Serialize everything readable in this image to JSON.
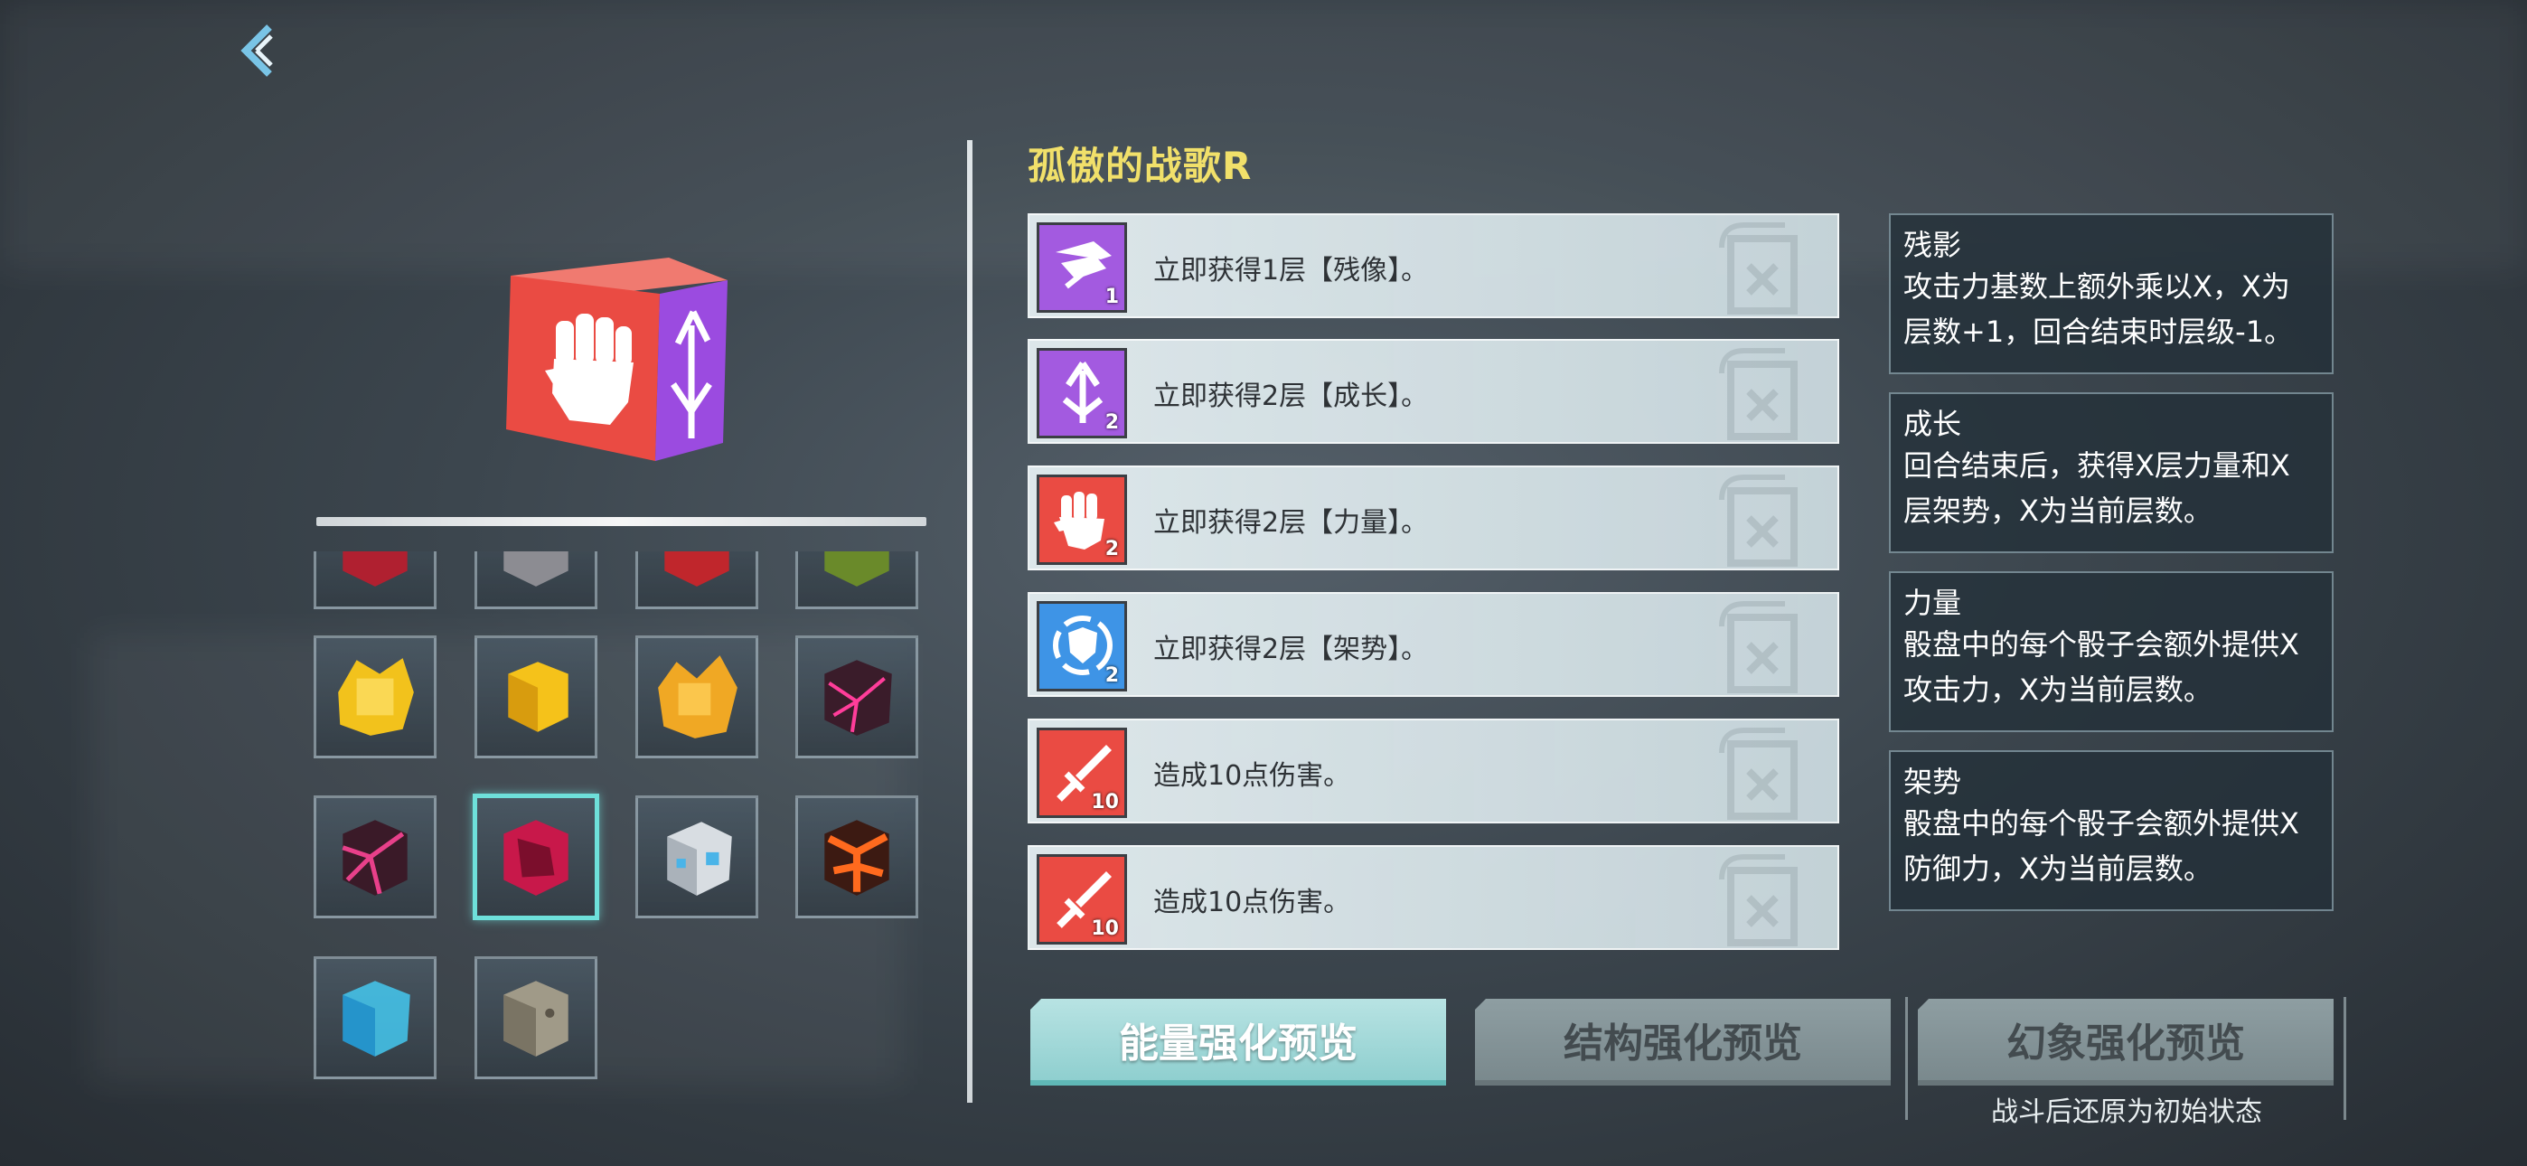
{
  "title": "孤傲的战歌R",
  "icons": {
    "back": "back-arrow-icon"
  },
  "effects": [
    {
      "text": "立即获得1层【残像】。",
      "count": "1",
      "icon": "afterimage-icon",
      "color": "#a35ae0"
    },
    {
      "text": "立即获得2层【成长】。",
      "count": "2",
      "icon": "growth-icon",
      "color": "#a35ae0"
    },
    {
      "text": "立即获得2层【力量】。",
      "count": "2",
      "icon": "fist-icon",
      "color": "#ea4b43"
    },
    {
      "text": "立即获得2层【架势】。",
      "count": "2",
      "icon": "shield-icon",
      "color": "#3e94e6"
    },
    {
      "text": "造成10点伤害。",
      "count": "10",
      "icon": "sword-icon",
      "color": "#ea4b43"
    },
    {
      "text": "造成10点伤害。",
      "count": "10",
      "icon": "sword-icon",
      "color": "#ea4b43"
    }
  ],
  "keywords": [
    {
      "name": "残影",
      "desc": [
        "攻击力基数上额外乘以X，X为",
        "层数+1，回合结束时层级-1。"
      ]
    },
    {
      "name": "成长",
      "desc": [
        "回合结束后，获得X层力量和X",
        "层架势，X为当前层数。"
      ]
    },
    {
      "name": "力量",
      "desc": [
        "骰盘中的每个骰子会额外提供X",
        "攻击力，X为当前层数。"
      ]
    },
    {
      "name": "架势",
      "desc": [
        "骰盘中的每个骰子会额外提供X",
        "防御力，X为当前层数。"
      ]
    }
  ],
  "tabs": [
    {
      "label": "能量强化预览",
      "active": true
    },
    {
      "label": "结构强化预览",
      "active": false
    },
    {
      "label": "幻象强化预览",
      "active": false
    }
  ],
  "note": "战斗后还原为初始状态",
  "dice": [
    {
      "name": "dice-partial-1",
      "color": "#b02030"
    },
    {
      "name": "dice-partial-2",
      "color": "#8c8c92"
    },
    {
      "name": "dice-partial-3",
      "color": "#c0262c"
    },
    {
      "name": "dice-partial-4",
      "color": "#6a8a2a"
    },
    {
      "name": "dice-gold-crystal",
      "color": "#f2c21c"
    },
    {
      "name": "dice-gold-smooth",
      "color": "#f5c21a"
    },
    {
      "name": "dice-gold-spiky",
      "color": "#f0a824"
    },
    {
      "name": "dice-dark-pink",
      "color": "#3a1c2a"
    },
    {
      "name": "dice-magenta-crack",
      "color": "#c0305e"
    },
    {
      "name": "dice-crimson",
      "color": "#c8184a"
    },
    {
      "name": "dice-white",
      "color": "#d8dde2"
    },
    {
      "name": "dice-lava",
      "color": "#b8401c"
    },
    {
      "name": "dice-ice",
      "color": "#44c8f0"
    },
    {
      "name": "dice-stone",
      "color": "#a09a88"
    }
  ],
  "selected_dice": "dice-crimson"
}
